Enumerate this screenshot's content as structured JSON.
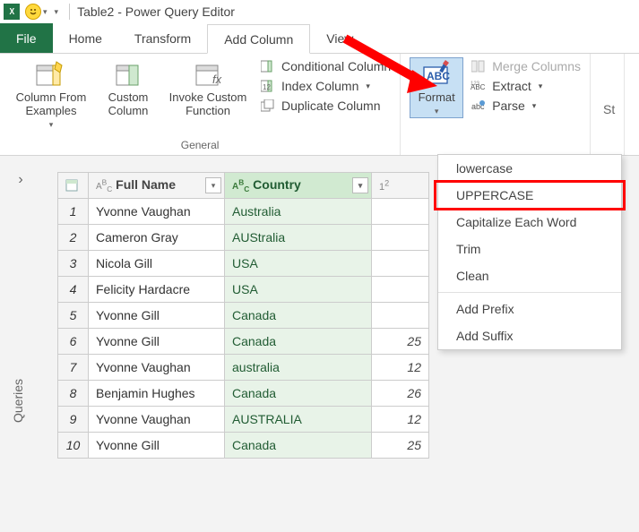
{
  "title": "Table2 - Power Query Editor",
  "tabs": {
    "file": "File",
    "home": "Home",
    "transform": "Transform",
    "addcol": "Add Column",
    "view": "View"
  },
  "ribbon": {
    "general_label": "General",
    "col_from_examples": "Column From Examples",
    "custom_column": "Custom Column",
    "invoke_custom": "Invoke Custom Function",
    "conditional": "Conditional Column",
    "index": "Index Column",
    "duplicate": "Duplicate Column",
    "format": "Format",
    "merge": "Merge Columns",
    "extract": "Extract",
    "parse": "Parse",
    "s_truncated": "St"
  },
  "dropdown": {
    "lowercase": "lowercase",
    "uppercase": "UPPERCASE",
    "capitalize": "Capitalize Each Word",
    "trim": "Trim",
    "clean": "Clean",
    "addprefix": "Add Prefix",
    "addsuffix": "Add Suffix"
  },
  "sidebar": {
    "queries": "Queries"
  },
  "columns": {
    "name": "Full Name",
    "country": "Country"
  },
  "rows": [
    {
      "n": "1",
      "name": "Yvonne Vaughan",
      "country": "Australia",
      "num": ""
    },
    {
      "n": "2",
      "name": "Cameron Gray",
      "country": "AUStralia",
      "num": ""
    },
    {
      "n": "3",
      "name": "Nicola Gill",
      "country": "USA",
      "num": ""
    },
    {
      "n": "4",
      "name": "Felicity Hardacre",
      "country": "USA",
      "num": ""
    },
    {
      "n": "5",
      "name": "Yvonne Gill",
      "country": "Canada",
      "num": ""
    },
    {
      "n": "6",
      "name": "Yvonne Gill",
      "country": "Canada",
      "num": "25"
    },
    {
      "n": "7",
      "name": "Yvonne Vaughan",
      "country": "australia",
      "num": "12"
    },
    {
      "n": "8",
      "name": "Benjamin Hughes",
      "country": "Canada",
      "num": "26"
    },
    {
      "n": "9",
      "name": "Yvonne Vaughan",
      "country": "AUSTRALIA",
      "num": "12"
    },
    {
      "n": "10",
      "name": "Yvonne Gill",
      "country": "Canada",
      "num": "25"
    }
  ]
}
